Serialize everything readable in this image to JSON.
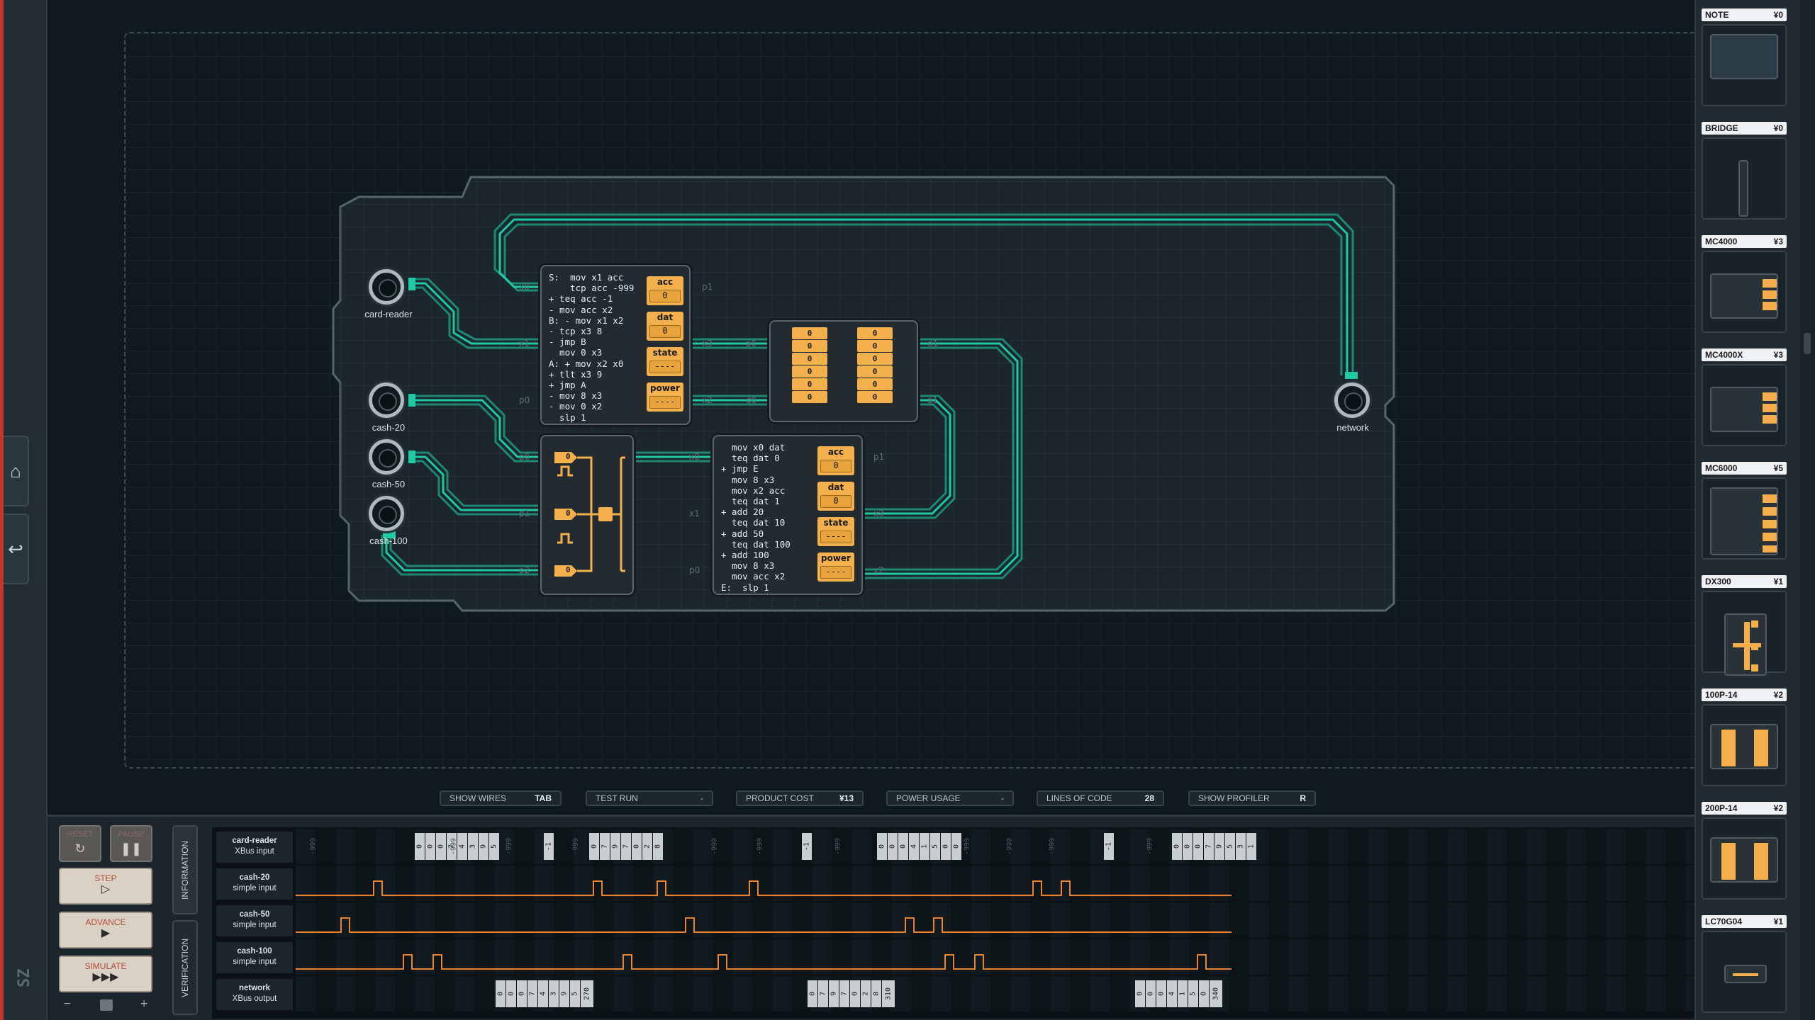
{
  "toolbar": {
    "show_wires": "SHOW WIRES",
    "show_wires_key": "TAB",
    "test_run": "TEST RUN",
    "test_run_val": "-",
    "product_cost": "PRODUCT COST",
    "product_cost_val": "¥13",
    "power_usage": "POWER USAGE",
    "power_usage_val": "-",
    "lines_of_code": "LINES OF CODE",
    "lines_of_code_val": "28",
    "show_profiler": "SHOW PROFILER",
    "show_profiler_key": "R"
  },
  "ports": {
    "card_reader": "card-reader",
    "cash20": "cash-20",
    "cash50": "cash-50",
    "cash100": "cash-100",
    "network": "network"
  },
  "chip1": {
    "code": "S:  mov x1 acc\n    tcp acc -999\n+ teq acc -1\n- mov acc x2\nB: - mov x1 x2\n- tcp x3 8\n- jmp B\n  mov 0 x3\nA: + mov x2 x0\n+ tlt x3 9\n+ jmp A\n- mov 8 x3\n- mov 0 x2\n  slp 1",
    "regs": [
      {
        "label": "acc",
        "value": "0"
      },
      {
        "label": "dat",
        "value": "0"
      },
      {
        "label": "state",
        "value": "----"
      },
      {
        "label": "power",
        "value": "----"
      }
    ],
    "pins": {
      "x0": "x0",
      "x1": "x1",
      "p0": "p0",
      "p1": "p1",
      "x3": "x3",
      "x2": "x2"
    }
  },
  "chip2": {
    "code": "  mov x0 dat\n  teq dat 0\n+ jmp E\n  mov 8 x3\n  mov x2 acc\n  teq dat 1\n+ add 20\n  teq dat 10\n+ add 50\n  teq dat 100\n+ add 100\n  mov 8 x3\n  mov acc x2\nE:  slp 1",
    "regs": [
      {
        "label": "acc",
        "value": "0"
      },
      {
        "label": "dat",
        "value": "0"
      },
      {
        "label": "state",
        "value": "----"
      },
      {
        "label": "power",
        "value": "----"
      }
    ],
    "pins": {
      "x0": "x0",
      "x1": "x1",
      "p0": "p0",
      "p1": "p1",
      "x3": "x3",
      "x2": "x2"
    }
  },
  "ram": {
    "cells": [
      "0",
      "0",
      "0",
      "0",
      "0",
      "0",
      "0",
      "0",
      "0",
      "0",
      "0",
      "0"
    ],
    "pins": {
      "a0": "a0",
      "d0": "d0",
      "d1": "d1",
      "a1": "a1",
      "x3": "x3",
      "x2": "x2"
    }
  },
  "dx": {
    "pins": {
      "p0": "p0",
      "p1": "p1",
      "p2": "p2",
      "x0": "x0"
    },
    "vals": [
      "0",
      "0",
      "0"
    ]
  },
  "console": {
    "reset": "RESET",
    "pause": "PAUSE",
    "step": "STEP",
    "advance": "ADVANCE",
    "simulate": "SIMULATE",
    "tab_info": "INFORMATION",
    "tab_verif": "VERIFICATION",
    "slider_minus": "−",
    "slider_plus": "+"
  },
  "signals": [
    {
      "name": "card-reader",
      "type": "XBus input",
      "packets": [
        {
          "vals": [
            "-999"
          ]
        },
        {
          "vals": [
            "0",
            "0",
            "0",
            "7",
            "4",
            "3",
            "9",
            "5"
          ]
        },
        {
          "vals": [
            "-999"
          ]
        },
        {
          "vals": [
            "-999"
          ]
        },
        {
          "vals": [
            "-1"
          ]
        },
        {
          "vals": [
            "-999"
          ]
        },
        {
          "vals": [
            "0",
            "7",
            "9",
            "7",
            "0",
            "2",
            "8"
          ]
        },
        {
          "vals": [
            "-999"
          ]
        },
        {
          "vals": [
            "-999"
          ]
        },
        {
          "vals": [
            "-1"
          ]
        },
        {
          "vals": [
            "-999"
          ]
        },
        {
          "vals": [
            "0",
            "0",
            "0",
            "4",
            "1",
            "5",
            "0",
            "0"
          ]
        },
        {
          "vals": [
            "-999"
          ]
        },
        {
          "vals": [
            "-999"
          ]
        },
        {
          "vals": [
            "-999"
          ]
        },
        {
          "vals": [
            "-1"
          ]
        },
        {
          "vals": [
            "-999"
          ]
        },
        {
          "vals": [
            "0",
            "0",
            "0",
            "7",
            "9",
            "5",
            "3",
            "1"
          ]
        }
      ]
    },
    {
      "name": "cash-20",
      "type": "simple input"
    },
    {
      "name": "cash-50",
      "type": "simple input"
    },
    {
      "name": "cash-100",
      "type": "simple input"
    },
    {
      "name": "network",
      "type": "XBus output",
      "packets": [
        {
          "vals": [
            "0",
            "0",
            "0",
            "7",
            "4",
            "3",
            "9",
            "5",
            "270"
          ]
        },
        {
          "vals": [
            "0",
            "7",
            "9",
            "7",
            "0",
            "2",
            "8",
            "310"
          ]
        },
        {
          "vals": [
            "0",
            "0",
            "0",
            "4",
            "1",
            "5",
            "0",
            "340"
          ]
        }
      ]
    }
  ],
  "shop": [
    {
      "name": "NOTE",
      "price": "¥0"
    },
    {
      "name": "BRIDGE",
      "price": "¥0"
    },
    {
      "name": "MC4000",
      "price": "¥3"
    },
    {
      "name": "MC4000X",
      "price": "¥3"
    },
    {
      "name": "MC6000",
      "price": "¥5"
    },
    {
      "name": "DX300",
      "price": "¥1"
    },
    {
      "name": "100P-14",
      "price": "¥2"
    },
    {
      "name": "200P-14",
      "price": "¥2"
    },
    {
      "name": "LC70G04",
      "price": "¥1"
    }
  ],
  "colors": {
    "wire": "#1fc9a4",
    "register": "#f4b04d",
    "signal": "#e8832f",
    "accent_red": "#c2352a"
  }
}
